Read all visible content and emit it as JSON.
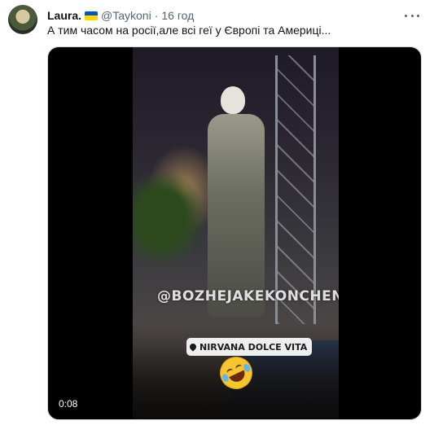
{
  "tweet": {
    "author": {
      "name": "Laura.",
      "flag": {
        "icon": "ukraine-flag-icon",
        "top_color": "#0057b7",
        "bottom_color": "#ffd700"
      },
      "handle": "@Taykoni",
      "separator": "·",
      "time": "16 год"
    },
    "text": "А тим часом на росії,але всі геї у Європі та Америці...",
    "more_icon": "more-horizontal-icon",
    "media": {
      "type": "video",
      "overlay_handle": "@BOZHEJAKEKONCHENE",
      "location_label": "NIRVANA DOLCE VITA",
      "location_icon": "location-pin-icon",
      "emoji": "face-with-tears-of-joy-icon",
      "duration": "0:08"
    }
  },
  "colors": {
    "text_primary": "#0f1419",
    "text_secondary": "#536471",
    "media_border": "#cfd9de"
  }
}
